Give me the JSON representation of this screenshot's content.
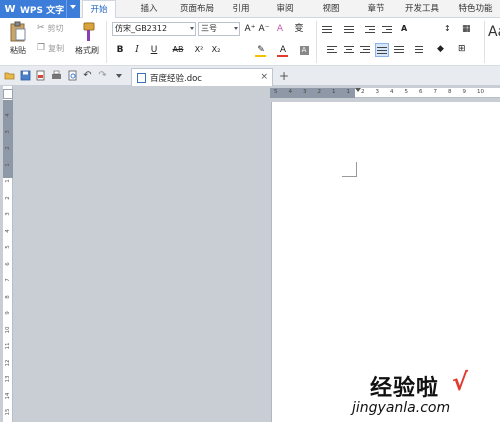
{
  "app": {
    "logo_glyph": "W",
    "name": "WPS 文字"
  },
  "menu_tabs": [
    "开始",
    "插入",
    "页面布局",
    "引用",
    "审阅",
    "视图",
    "章节",
    "开发工具",
    "特色功能"
  ],
  "active_tab": "开始",
  "ribbon": {
    "paste_label": "粘贴",
    "cut_label": "剪切",
    "copy_label": "复制",
    "format_painter_label": "格式刷",
    "font_name": "仿宋_GB2312",
    "font_size": "三号",
    "style_preview": "Aa",
    "bold_glyph": "B",
    "italic_glyph": "I",
    "underline_glyph": "U",
    "strike_glyph": "AB",
    "superscript_glyph": "X²",
    "subscript_glyph": "X₂",
    "grow_font_glyph": "A⁺",
    "shrink_font_glyph": "A⁻",
    "clear_format_glyph": "A",
    "pinyin_glyph": "变"
  },
  "document_tab": {
    "title": "百度经验.doc",
    "close_glyph": "×",
    "new_tab_glyph": "+"
  },
  "rulers": {
    "horizontal": [
      "5",
      "4",
      "3",
      "2",
      "1",
      "1",
      "2",
      "3",
      "4",
      "5",
      "6",
      "7",
      "8",
      "9",
      "10"
    ],
    "vertical": [
      "4",
      "3",
      "2",
      "1",
      "1",
      "2",
      "3",
      "4",
      "5",
      "6",
      "7",
      "8",
      "9",
      "10",
      "11",
      "12",
      "13",
      "14",
      "15"
    ]
  },
  "watermark": {
    "title": "经验啦",
    "check": "√",
    "url": "jingyanla.com"
  },
  "colors": {
    "accent": "#3b7dd8",
    "font_color": "#e23b30",
    "highlight": "#f2c200"
  }
}
